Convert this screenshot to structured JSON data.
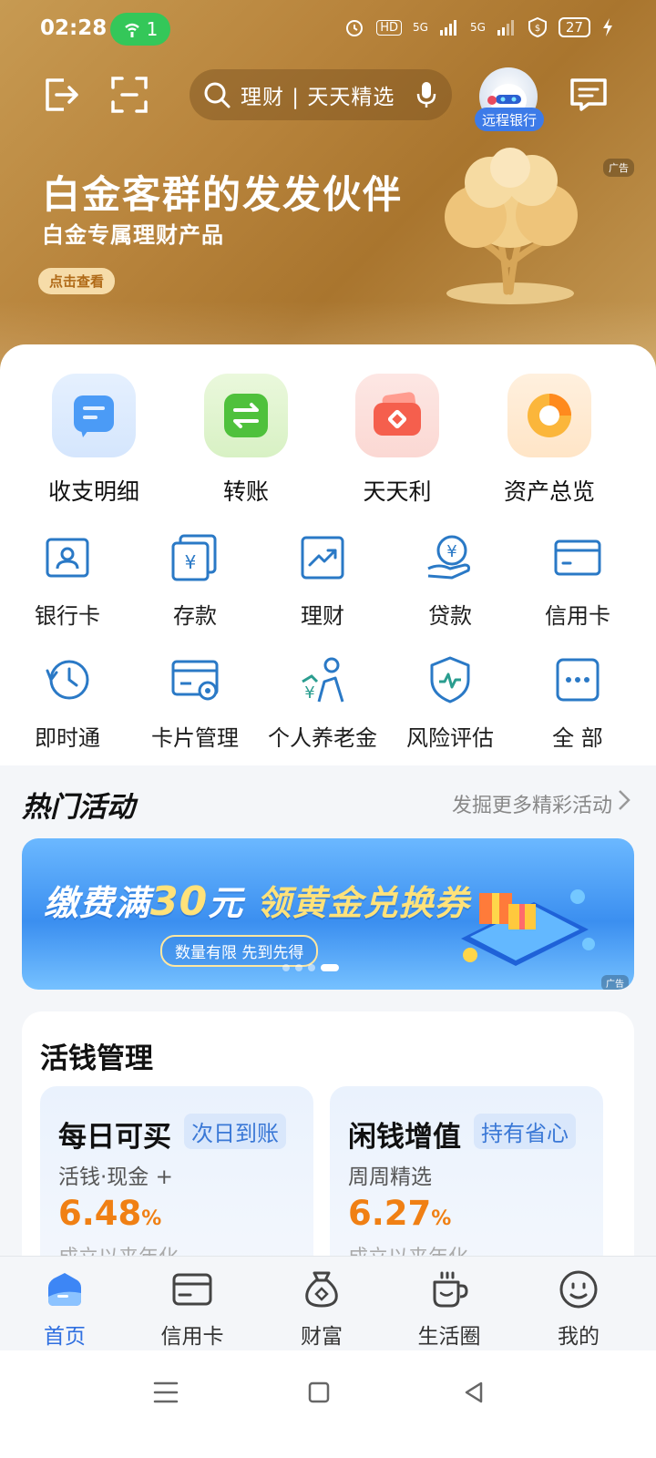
{
  "status": {
    "time": "02:28",
    "hotspot_count": "1",
    "net1": "HD",
    "net2": "5G",
    "net3": "5G",
    "battery": "27"
  },
  "search": {
    "placeholder": "理财 | 天天精选"
  },
  "avatar": {
    "tag": "远程银行"
  },
  "hero": {
    "title": "白金客群的发发伙伴",
    "subtitle": "白金专属理财产品",
    "button": "点击查看",
    "ad_tag": "广告"
  },
  "quick": [
    {
      "label": "收支明细",
      "icon": "statement-icon"
    },
    {
      "label": "转账",
      "icon": "transfer-icon"
    },
    {
      "label": "天天利",
      "icon": "wallet-icon"
    },
    {
      "label": "资产总览",
      "icon": "pie-chart-icon"
    }
  ],
  "grid_row1": [
    {
      "label": "银行卡",
      "icon": "bank-card-icon"
    },
    {
      "label": "存款",
      "icon": "deposit-icon"
    },
    {
      "label": "理财",
      "icon": "finance-icon"
    },
    {
      "label": "贷款",
      "icon": "loan-icon"
    },
    {
      "label": "信用卡",
      "icon": "credit-card-icon"
    }
  ],
  "grid_row2": [
    {
      "label": "即时通",
      "icon": "clock-icon"
    },
    {
      "label": "卡片管理",
      "icon": "card-settings-icon"
    },
    {
      "label": "个人养老金",
      "icon": "pension-icon"
    },
    {
      "label": "风险评估",
      "icon": "shield-icon"
    },
    {
      "label": "全 部",
      "icon": "more-icon"
    }
  ],
  "activities": {
    "title": "热门活动",
    "more": "发掘更多精彩活动"
  },
  "promo": {
    "title_a": "缴费满",
    "title_num": "30",
    "title_b": "元 ",
    "title_c": "领黄金兑换券",
    "pill": "数量有限 先到先得",
    "ad_tag": "广告",
    "page_count": 4,
    "active_page": 3
  },
  "money": {
    "title": "活钱管理",
    "cards": [
      {
        "title": "每日可买",
        "tag": "次日到账",
        "sub": "活钱·现金 +",
        "rate": "6.48",
        "unit": "%",
        "cut": "成立以来年化"
      },
      {
        "title": "闲钱增值",
        "tag": "持有省心",
        "sub": "周周精选",
        "rate": "6.27",
        "unit": "%",
        "cut": "成立以来年化"
      }
    ]
  },
  "nav": [
    {
      "label": "首页",
      "icon": "home-icon",
      "active": true
    },
    {
      "label": "信用卡",
      "icon": "credit-card-icon",
      "active": false
    },
    {
      "label": "财富",
      "icon": "wealth-bag-icon",
      "active": false
    },
    {
      "label": "生活圈",
      "icon": "cup-icon",
      "active": false
    },
    {
      "label": "我的",
      "icon": "profile-icon",
      "active": false
    }
  ],
  "colors": {
    "gold": "#b8843c",
    "accent_blue": "#2f6fe0",
    "rate_orange": "#f08014",
    "icon_blue": "#2a79c6"
  }
}
